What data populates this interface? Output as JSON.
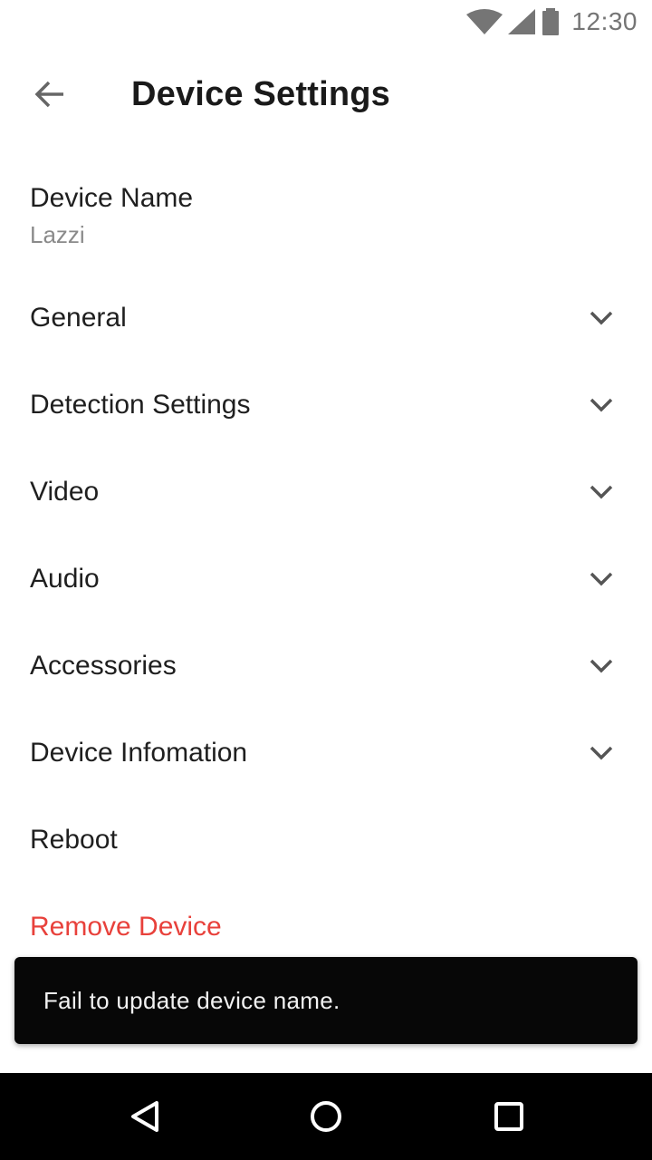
{
  "status_bar": {
    "time": "12:30",
    "icons": [
      "wifi-icon",
      "signal-icon",
      "battery-icon"
    ]
  },
  "app_bar": {
    "title": "Device Settings",
    "back_icon": "arrow-left-icon"
  },
  "device_name": {
    "label": "Device Name",
    "value": "Lazzi"
  },
  "settings": {
    "items": [
      {
        "label": "General",
        "expandable": true
      },
      {
        "label": "Detection Settings",
        "expandable": true
      },
      {
        "label": "Video",
        "expandable": true
      },
      {
        "label": "Audio",
        "expandable": true
      },
      {
        "label": "Accessories",
        "expandable": true
      },
      {
        "label": "Device Infomation",
        "expandable": true
      },
      {
        "label": "Reboot",
        "expandable": false
      },
      {
        "label": "Remove Device",
        "expandable": false
      }
    ]
  },
  "snackbar": {
    "message": "Fail to update device name."
  },
  "nav_bar": {
    "icons": [
      "back-triangle-icon",
      "home-circle-icon",
      "recents-square-icon"
    ]
  },
  "colors": {
    "danger": "#e8413b",
    "text_primary": "#1f1f1f",
    "text_secondary": "#8a8a8a",
    "snackbar_bg": "#070707"
  }
}
